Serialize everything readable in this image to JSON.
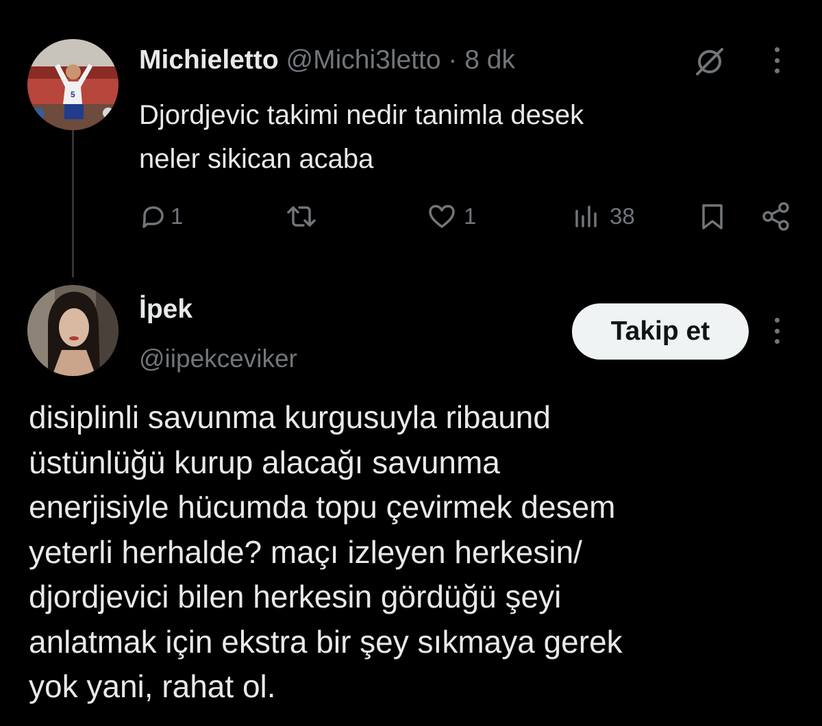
{
  "tweet1": {
    "display_name": "Michieletto",
    "handle": "@Michi3letto",
    "separator": "·",
    "time": "8 dk",
    "text_line1": "Djordjevic takimi nedir tanimla desek",
    "text_line2": "neler sikican acaba",
    "reply_count": "1",
    "like_count": "1",
    "view_count": "38",
    "icons": [
      "grok-icon",
      "more-icon",
      "reply-icon",
      "retweet-icon",
      "like-icon",
      "views-icon",
      "bookmark-icon",
      "share-icon"
    ]
  },
  "tweet2": {
    "display_name": "İpek",
    "handle": "@iipekceviker",
    "follow_label": "Takip et",
    "text_lines": [
      "disiplinli savunma kurgusuyla ribaund",
      "üstünlüğü kurup alacağı savunma",
      "enerjisiyle hücumda topu çevirmek desem",
      "yeterli herhalde? maçı izleyen herkesin/",
      "djordjevici bilen herkesin gördüğü şeyi",
      "anlatmak için ekstra bir şey sıkmaya gerek",
      "yok yani, rahat ol."
    ]
  },
  "colors": {
    "background": "#000000",
    "primary_text": "#e7e9ea",
    "secondary_text": "#71767b",
    "follow_button_bg": "#eff3f4",
    "follow_button_text": "#0f1419",
    "thread_line": "#333639"
  }
}
